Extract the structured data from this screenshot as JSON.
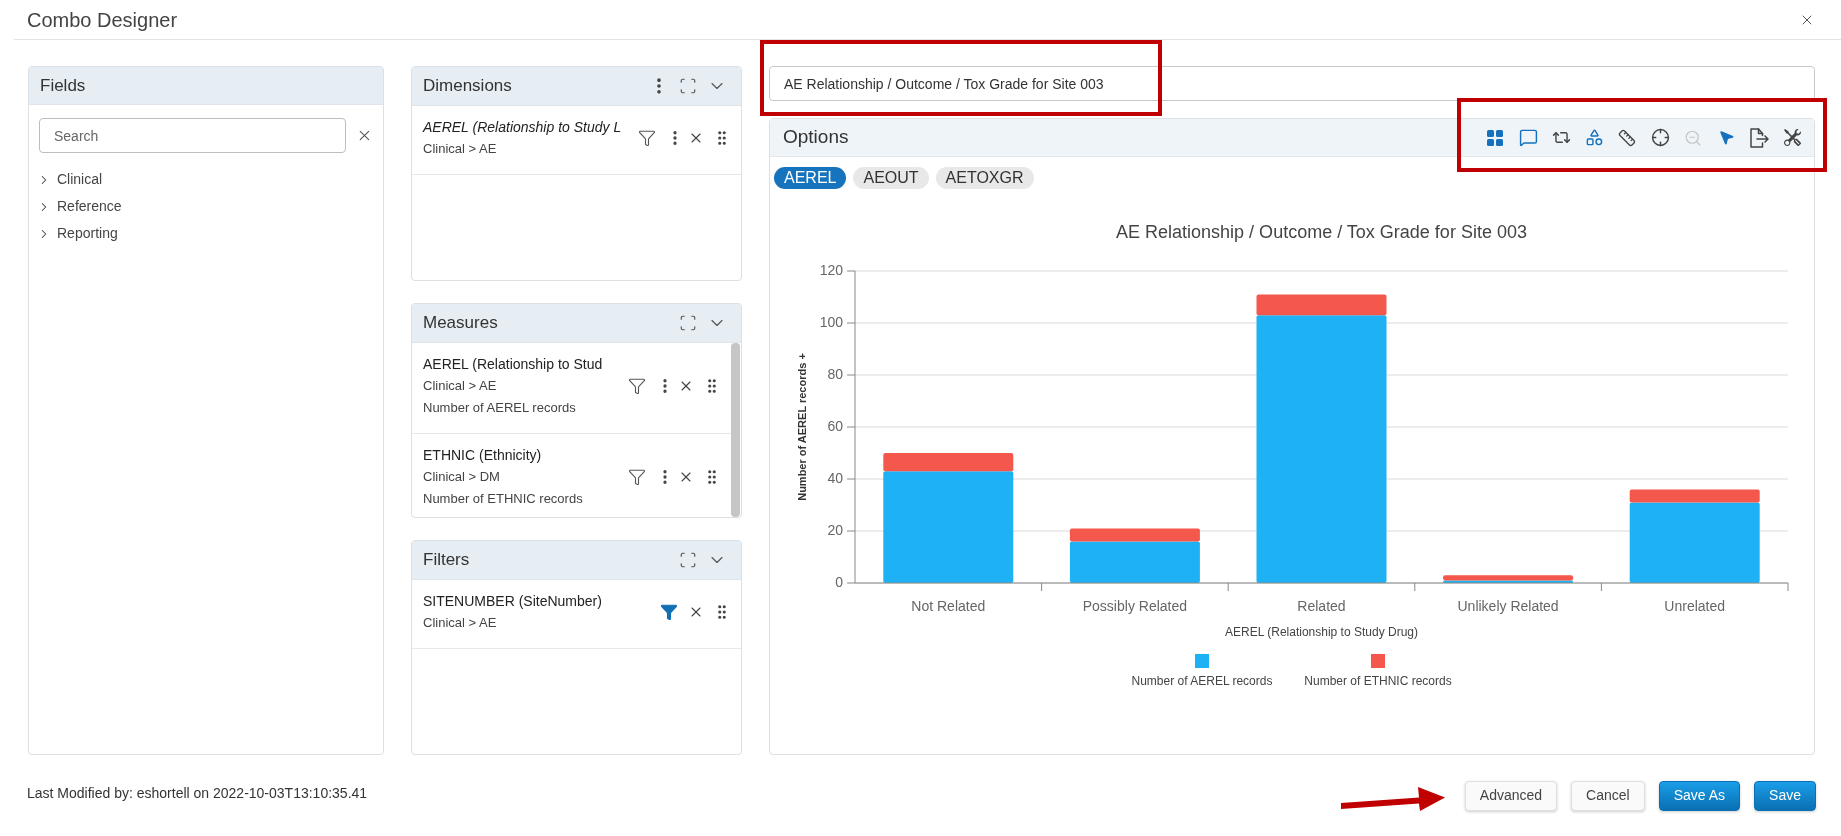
{
  "window": {
    "title": "Combo Designer"
  },
  "fields": {
    "title": "Fields",
    "search": {
      "placeholder": "Search"
    },
    "tree": [
      {
        "label": "Clinical",
        "expanded": false
      },
      {
        "label": "Reference",
        "expanded": false
      },
      {
        "label": "Reporting",
        "expanded": false
      }
    ]
  },
  "panels": [
    {
      "kind": "dimensions",
      "title": "Dimensions",
      "items": [
        {
          "name": "AEREL (Relationship to Study L",
          "path": "Clinical > AE",
          "filtered": false
        }
      ]
    },
    {
      "kind": "measures",
      "title": "Measures",
      "items": [
        {
          "name": "AEREL (Relationship to Stud",
          "path": "Clinical > AE",
          "detail": "Number of AEREL records",
          "filtered": false
        },
        {
          "name": "ETHNIC (Ethnicity)",
          "path": "Clinical > DM",
          "detail": "Number of ETHNIC records",
          "filtered": false
        }
      ]
    },
    {
      "kind": "filters",
      "title": "Filters",
      "items": [
        {
          "name": "SITENUMBER (SiteNumber)",
          "path": "Clinical > AE",
          "filtered": true
        }
      ]
    }
  ],
  "chart_title_field": {
    "value": "AE Relationship / Outcome / Tox Grade for Site 003",
    "highlighted": true
  },
  "options": {
    "title": "Options",
    "toolbar": {
      "highlighted": true,
      "buttons": [
        {
          "active": true,
          "disabled": false
        },
        {
          "active": true,
          "disabled": false
        },
        {
          "active": false,
          "disabled": false
        },
        {
          "active": true,
          "disabled": false
        },
        {
          "active": false,
          "disabled": false
        },
        {
          "active": false,
          "disabled": false
        },
        {
          "active": false,
          "disabled": true
        },
        {
          "active": true,
          "disabled": false
        },
        {
          "active": false,
          "disabled": false
        },
        {
          "active": false,
          "disabled": false
        }
      ]
    },
    "tabs": [
      {
        "label": "AEREL",
        "selected": true
      },
      {
        "label": "AEOUT",
        "selected": false
      },
      {
        "label": "AETOXGR",
        "selected": false
      }
    ],
    "chart_data": {
      "type": "bar",
      "title": "AE Relationship / Outcome / Tox Grade for Site 003",
      "xlabel": "AEREL (Relationship to Study Drug)",
      "ylabel": "Number of AEREL records +",
      "categories": [
        "Not Related",
        "Possibly Related",
        "Related",
        "Unlikely Related",
        "Unrelated"
      ],
      "series": [
        {
          "name": "Number of AEREL records",
          "color": "#1eb1f4",
          "values": [
            43,
            16,
            103,
            1,
            31
          ]
        },
        {
          "name": "Number of ETHNIC records",
          "color": "#f4574b",
          "values": [
            7,
            5,
            8,
            2,
            5
          ]
        }
      ],
      "ylim": [
        0,
        120
      ],
      "yticks": [
        0,
        20,
        40,
        60,
        80,
        100,
        120
      ],
      "stacked": true,
      "grid": true,
      "legend": true
    }
  },
  "footer": {
    "last_modified": "Last Modified by: eshortell on 2022-10-03T13:10:35.41",
    "buttons": [
      {
        "label": "Advanced",
        "kind": "secondary",
        "highlighted": true
      },
      {
        "label": "Cancel",
        "kind": "secondary",
        "highlighted": false
      },
      {
        "label": "Save As",
        "kind": "primary",
        "highlighted": false
      },
      {
        "label": "Save",
        "kind": "primary",
        "highlighted": false
      }
    ]
  }
}
